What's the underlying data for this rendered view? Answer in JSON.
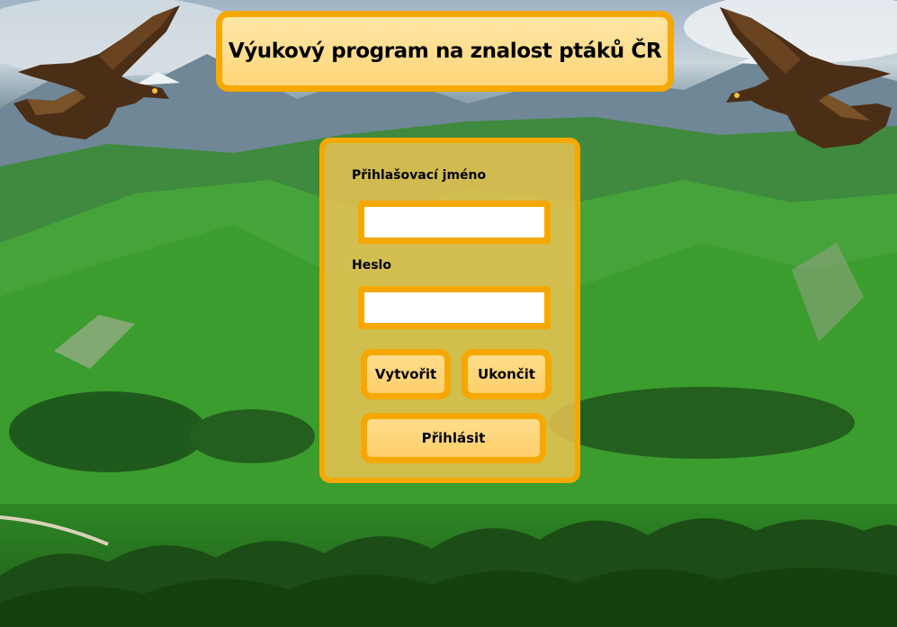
{
  "app": {
    "title": "Výukový program na znalost ptáků ČR"
  },
  "login": {
    "username_label": "Přihlašovací jméno",
    "username_value": "",
    "password_label": "Heslo",
    "password_value": "",
    "create_button": "Vytvořit",
    "quit_button": "Ukončit",
    "login_button": "Přihlásit"
  },
  "colors": {
    "accent": "#f6a800",
    "panel_fill": "#f2c654",
    "button_fill": "#ffd57a"
  },
  "decorations": {
    "background": "mountain-landscape-image",
    "left_image": "eagle-icon",
    "right_image": "eagle-icon"
  }
}
